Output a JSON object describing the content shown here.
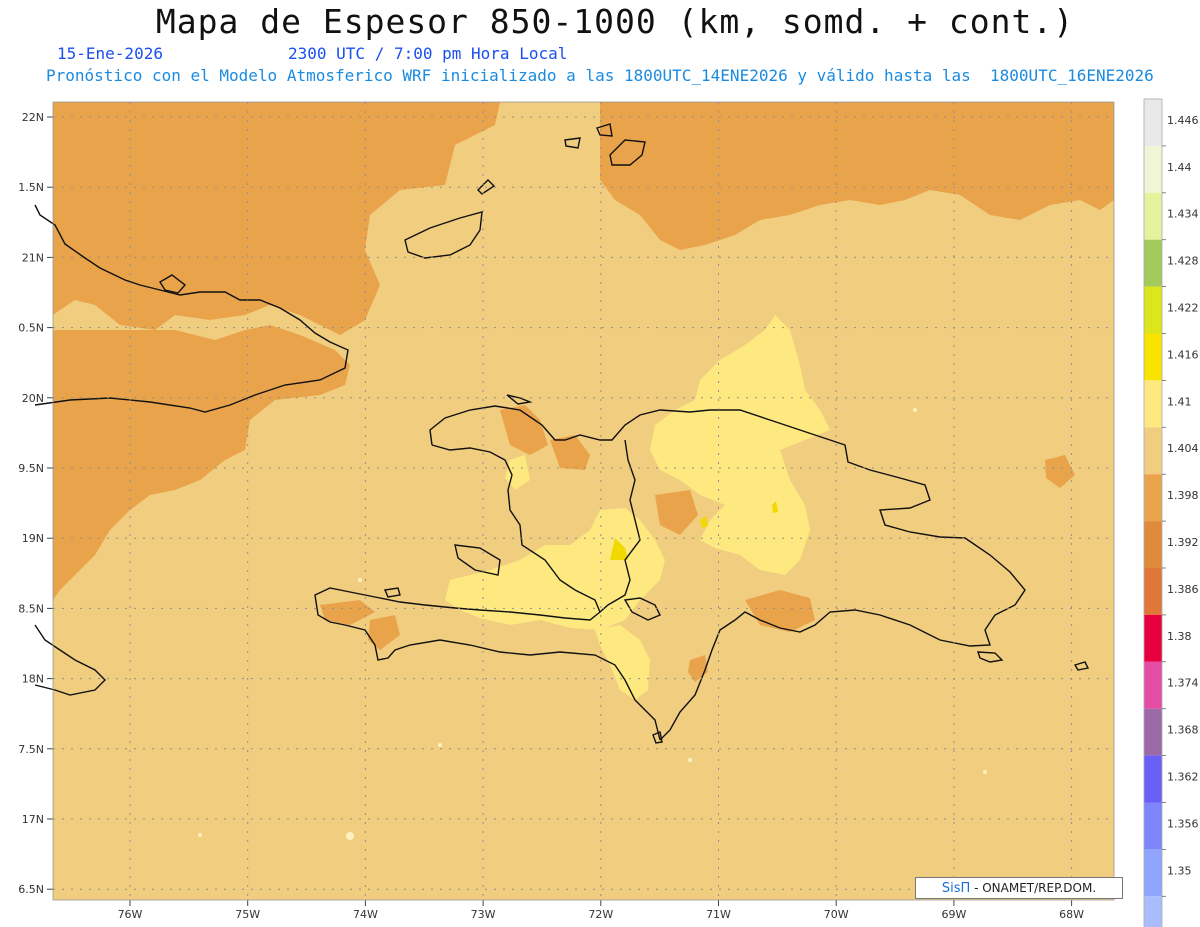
{
  "title": "Mapa de Espesor 850-1000 (km, somd. + cont.)",
  "date": "15-Ene-2026",
  "time": "2300 UTC / 7:00 pm Hora Local",
  "forecast_note": "Pronóstico con el Modelo Atmosferico WRF inicializado a las 1800UTC_14ENE2026 y válido hasta las  1800UTC_16ENE2026",
  "lat_labels": [
    "22N",
    "1.5N",
    "21N",
    "0.5N",
    "20N",
    "9.5N",
    "19N",
    "8.5N",
    "18N",
    "7.5N",
    "17N",
    "6.5N"
  ],
  "lon_labels": [
    "76W",
    "75W",
    "74W",
    "73W",
    "72W",
    "71W",
    "70W",
    "69W",
    "68W"
  ],
  "colorbar": {
    "labels": [
      "1.446",
      "1.44",
      "1.434",
      "1.428",
      "1.422",
      "1.416",
      "1.41",
      "1.404",
      "1.398",
      "1.392",
      "1.386",
      "1.38",
      "1.374",
      "1.368",
      "1.362",
      "1.356",
      "1.35"
    ],
    "colors": [
      "#e9e9e9",
      "#f1f5d6",
      "#e3f39e",
      "#a4c95c",
      "#dde61c",
      "#f8e400",
      "#fde97f",
      "#f1cd7f",
      "#e9a34b",
      "#df8a3d",
      "#de7738",
      "#e8003e",
      "#e54da5",
      "#9c6aa9",
      "#6a60f8",
      "#7f85fb",
      "#8fa5fd",
      "#a9bdfd"
    ]
  },
  "credit": {
    "brand": "SisΠ",
    "text": "- ONAMET/REP.DOM."
  },
  "colors": {
    "ocean": "#f1cd7f",
    "warm": "#e9a34b",
    "light": "#fde97f",
    "yellow": "#f1d900",
    "grid": "#8f8f8f",
    "coast": "#111111",
    "title_blue": "#1a4ff0",
    "note_blue": "#1a8be0"
  }
}
